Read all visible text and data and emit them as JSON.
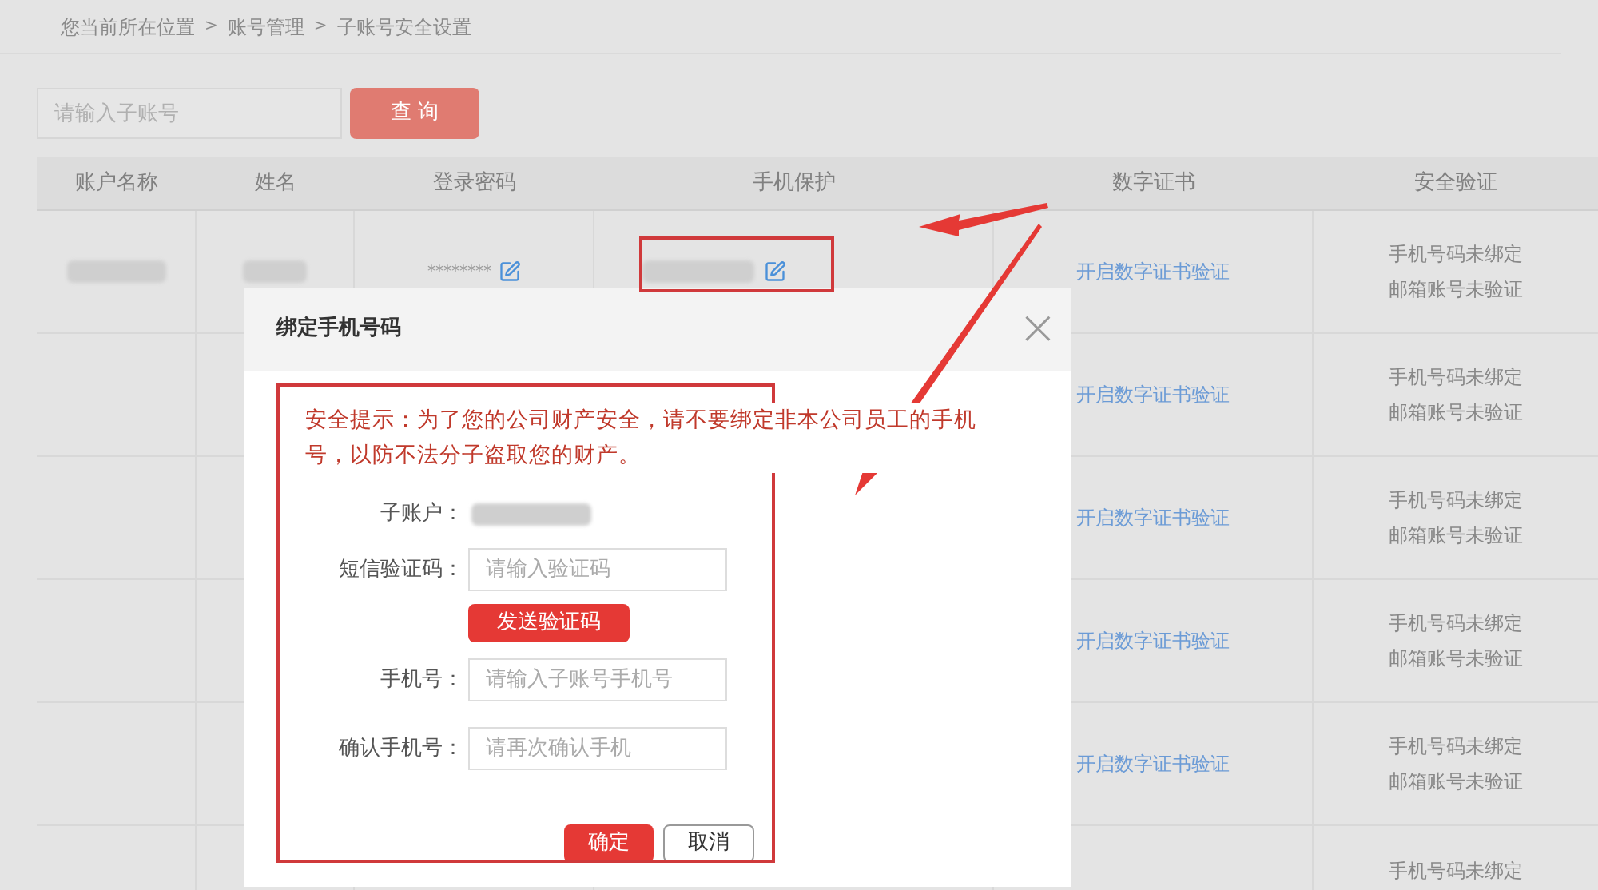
{
  "breadcrumb": {
    "items": [
      "您当前所在位置",
      "账号管理",
      "子账号安全设置"
    ],
    "separator": ">"
  },
  "search": {
    "placeholder": "请输入子账号",
    "button": "查 询"
  },
  "table": {
    "columns": [
      "账户名称",
      "姓名",
      "登录密码",
      "手机保护",
      "数字证书",
      "安全验证"
    ],
    "rows": [
      {
        "password": "********",
        "cert_link": "开启数字证书验证",
        "security": [
          "手机号码未绑定",
          "邮箱账号未验证"
        ]
      },
      {
        "cert_link": "开启数字证书验证",
        "security": [
          "手机号码未绑定",
          "邮箱账号未验证"
        ]
      },
      {
        "cert_link": "开启数字证书验证",
        "security": [
          "手机号码未绑定",
          "邮箱账号未验证"
        ]
      },
      {
        "cert_link": "开启数字证书验证",
        "security": [
          "手机号码未绑定",
          "邮箱账号未验证"
        ]
      },
      {
        "cert_link": "开启数字证书验证",
        "security": [
          "手机号码未绑定",
          "邮箱账号未验证"
        ]
      },
      {
        "security": [
          "手机号码未绑定"
        ]
      }
    ]
  },
  "modal": {
    "title": "绑定手机号码",
    "close": "×",
    "warning": "安全提示：为了您的公司财产安全，请不要绑定非本公司员工的手机号，以防不法分子盗取您的财产。",
    "fields": [
      {
        "kind": "text",
        "label": "子账户："
      },
      {
        "kind": "input",
        "label": "短信验证码：",
        "placeholder": "请输入验证码"
      },
      {
        "kind": "button",
        "label": "发送验证码"
      },
      {
        "kind": "input",
        "label": "手机号：",
        "placeholder": "请输入子账号手机号"
      },
      {
        "kind": "input",
        "label": "确认手机号：",
        "placeholder": "请再次确认手机"
      }
    ],
    "ok": "确定",
    "cancel": "取消"
  }
}
